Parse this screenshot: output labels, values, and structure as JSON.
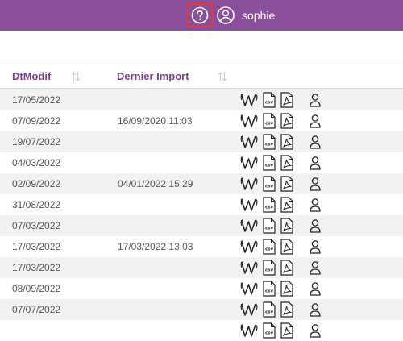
{
  "topbar": {
    "username": "sophie",
    "help_icon": "question-circle-icon",
    "user_icon": "user-circle-icon",
    "background_color": "#8a4f9b",
    "highlight_color": "#e53935"
  },
  "table": {
    "columns": [
      {
        "label": "DtModif",
        "sort_icon": "sort-arrows-icon"
      },
      {
        "label": "Dernier Import",
        "sort_icon": "sort-arrows-icon"
      }
    ],
    "header_color": "#7b3f8c",
    "row_icons": [
      "word-icon",
      "csv-file-icon",
      "pdf-file-icon",
      "user-icon"
    ],
    "rows": [
      {
        "dt_modif": "17/05/2022",
        "dernier_import": ""
      },
      {
        "dt_modif": "07/09/2022",
        "dernier_import": "16/09/2020 11:03"
      },
      {
        "dt_modif": "19/07/2022",
        "dernier_import": ""
      },
      {
        "dt_modif": "04/03/2022",
        "dernier_import": ""
      },
      {
        "dt_modif": "02/09/2022",
        "dernier_import": "04/01/2022 15:29"
      },
      {
        "dt_modif": "31/08/2022",
        "dernier_import": ""
      },
      {
        "dt_modif": "07/03/2022",
        "dernier_import": ""
      },
      {
        "dt_modif": "17/03/2022",
        "dernier_import": "17/03/2022 13:03"
      },
      {
        "dt_modif": "17/03/2022",
        "dernier_import": ""
      },
      {
        "dt_modif": "08/09/2022",
        "dernier_import": ""
      },
      {
        "dt_modif": "07/07/2022",
        "dernier_import": ""
      },
      {
        "dt_modif": "",
        "dernier_import": ""
      }
    ]
  }
}
